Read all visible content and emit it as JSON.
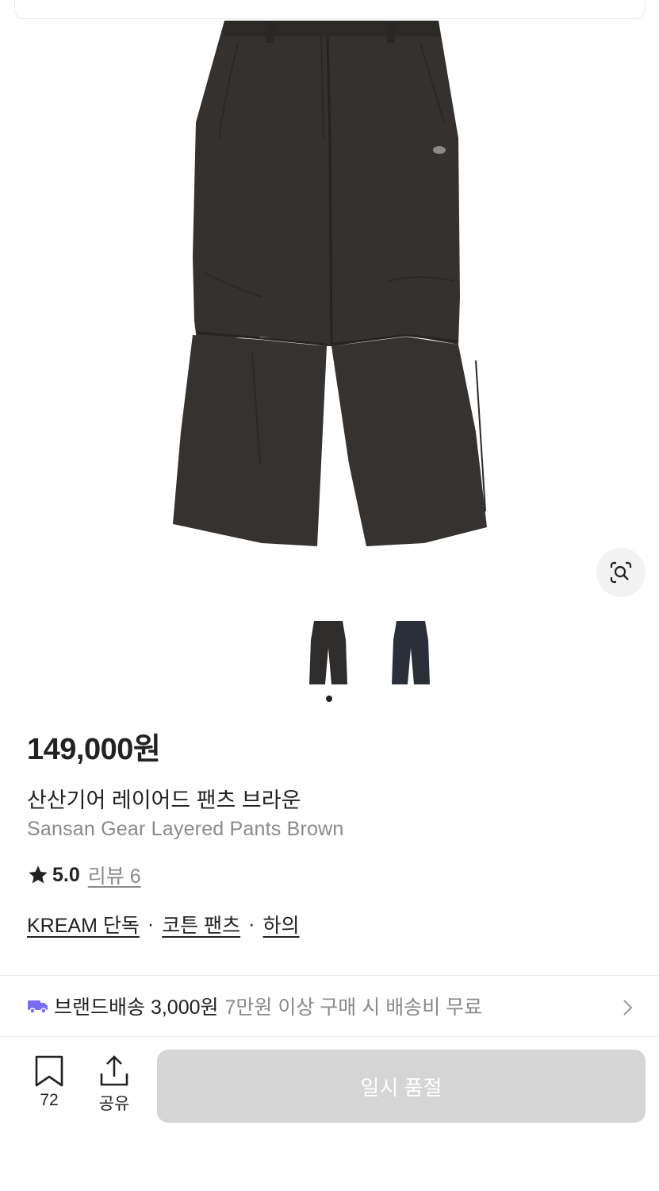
{
  "product": {
    "price": "149,000원",
    "name_ko": "산산기어 레이어드 팬츠 브라운",
    "name_en": "Sansan Gear Layered Pants Brown",
    "rating": "5.0",
    "review_label": "리뷰 6",
    "tags": [
      "KREAM 단독",
      "코튼 팬츠",
      "하의"
    ],
    "tag_separator": "·"
  },
  "gallery": {
    "thumbnails": [
      {
        "color": "#2f2d2b",
        "name": "brown"
      },
      {
        "color": "#2b2f3a",
        "name": "navy"
      }
    ],
    "active_index": 0
  },
  "shipping": {
    "main": "브랜드배송 3,000원",
    "sub": "7만원 이상 구매 시 배송비 무료",
    "icon_color": "#7b6cf6"
  },
  "actions": {
    "bookmark_count": "72",
    "share_label": "공유",
    "purchase_label": "일시 품절"
  },
  "colors": {
    "garment": "#34312e",
    "disabled_button": "#d5d5d5",
    "muted_text": "#8a8a8a"
  }
}
